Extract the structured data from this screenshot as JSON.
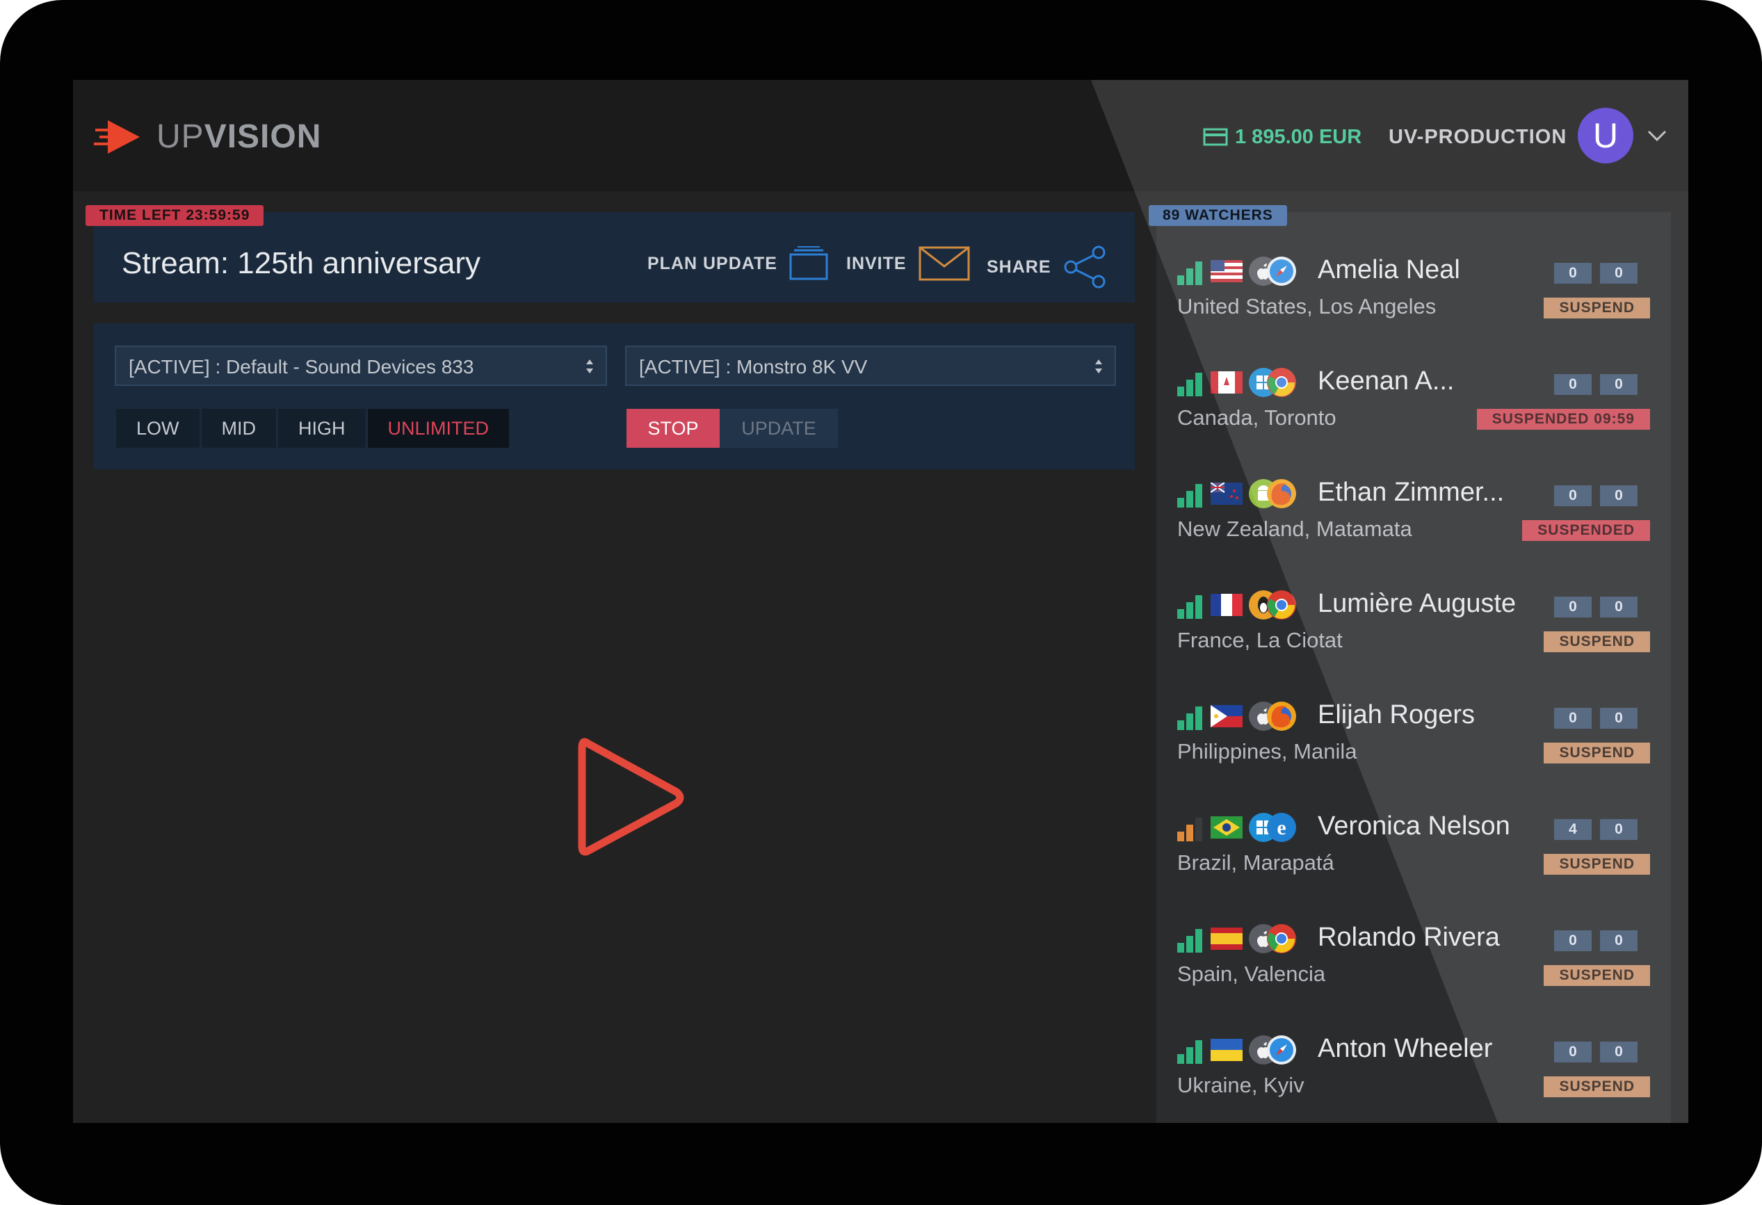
{
  "header": {
    "brand_up": "UP",
    "brand_vision": "VISION",
    "balance": "1 895.00 EUR",
    "account": "UV-PRODUCTION",
    "avatar_initial": "U"
  },
  "stream": {
    "time_left": "TIME LEFT 23:59:59",
    "title": "Stream: 125th anniversary",
    "actions": {
      "plan_update": "PLAN UPDATE",
      "invite": "INVITE",
      "share": "SHARE"
    }
  },
  "controls": {
    "audio_select": "[ACTIVE] : Default - Sound Devices 833",
    "video_select": "[ACTIVE] : Monstro 8K VV",
    "quality": [
      "LOW",
      "MID",
      "HIGH",
      "UNLIMITED"
    ],
    "quality_selected": "UNLIMITED",
    "stop": "STOP",
    "update": "UPDATE"
  },
  "watchers": {
    "badge": "89 WATCHERS",
    "list": [
      {
        "name": "Amelia Neal",
        "location": "United States, Los Angeles",
        "count_a": "0",
        "count_b": "0",
        "status": "SUSPEND",
        "signal": "good",
        "flag": "us",
        "os": "apple",
        "browser": "safari"
      },
      {
        "name": "Keenan A...",
        "location": "Canada, Toronto",
        "count_a": "0",
        "count_b": "0",
        "status": "SUSPENDED 09:59",
        "signal": "good",
        "flag": "ca",
        "os": "windows",
        "browser": "chrome"
      },
      {
        "name": "Ethan Zimmer...",
        "location": "New Zealand, Matamata",
        "count_a": "0",
        "count_b": "0",
        "status": "SUSPENDED",
        "signal": "good",
        "flag": "nz",
        "os": "android",
        "browser": "firefox"
      },
      {
        "name": "Lumière Auguste",
        "location": "France, La Ciotat",
        "count_a": "0",
        "count_b": "0",
        "status": "SUSPEND",
        "signal": "good",
        "flag": "fr",
        "os": "linux",
        "browser": "chrome"
      },
      {
        "name": "Elijah Rogers",
        "location": "Philippines, Manila",
        "count_a": "0",
        "count_b": "0",
        "status": "SUSPEND",
        "signal": "good",
        "flag": "ph",
        "os": "apple",
        "browser": "firefox"
      },
      {
        "name": "Veronica Nelson",
        "location": "Brazil, Marapatá",
        "count_a": "4",
        "count_b": "0",
        "status": "SUSPEND",
        "signal": "weak",
        "flag": "br",
        "os": "windows",
        "browser": "ie"
      },
      {
        "name": "Rolando Rivera",
        "location": "Spain, Valencia",
        "count_a": "0",
        "count_b": "0",
        "status": "SUSPEND",
        "signal": "good",
        "flag": "es",
        "os": "apple",
        "browser": "chrome"
      },
      {
        "name": "Anton Wheeler",
        "location": "Ukraine, Kyiv",
        "count_a": "0",
        "count_b": "0",
        "status": "SUSPEND",
        "signal": "good",
        "flag": "ua",
        "os": "apple",
        "browser": "safari"
      }
    ]
  },
  "colors": {
    "accent_red": "#d0465c",
    "balance_green": "#3fc591",
    "avatar": "#5b3fd4",
    "panel_blue": "#1a2a3c",
    "suspend": "#c6906a",
    "suspended": "#cf4a57"
  }
}
